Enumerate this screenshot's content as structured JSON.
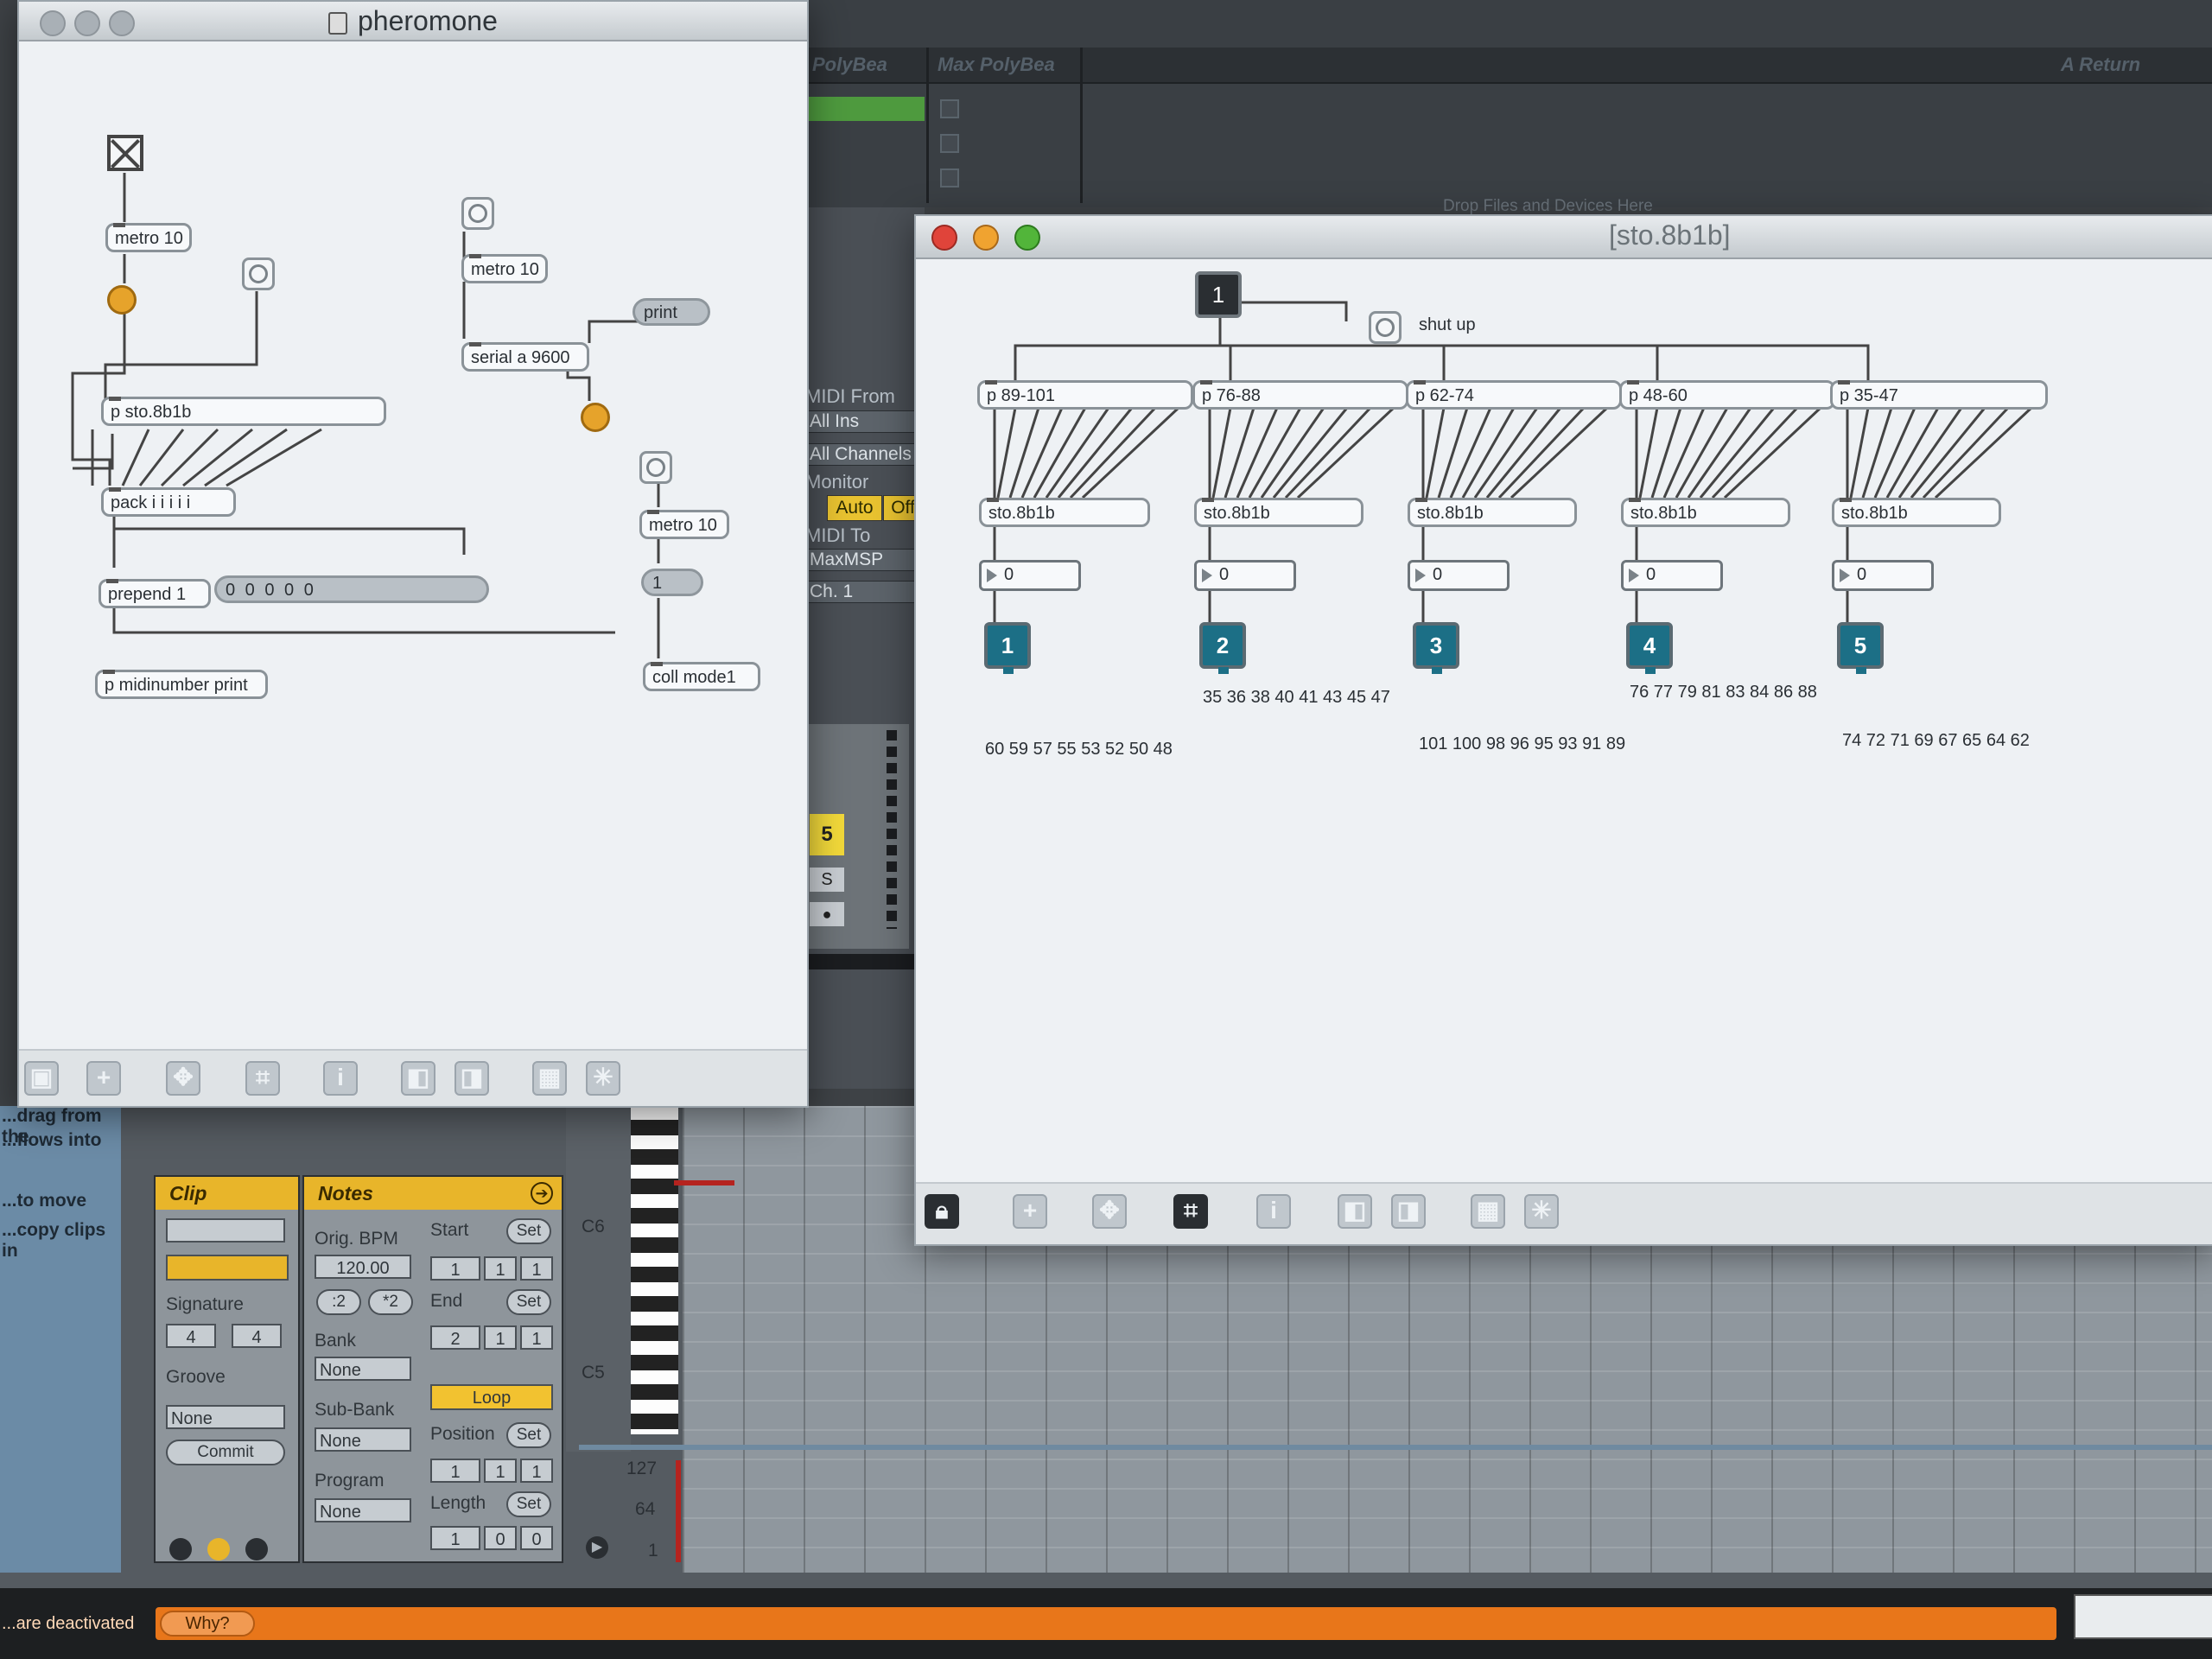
{
  "live": {
    "track_headers": [
      "PolyBea",
      "Max PolyBea",
      "A Return"
    ],
    "drop_hint": "Drop Files and Devices Here",
    "io": {
      "midi_from_label": "MIDI From",
      "midi_from_value": "All Ins",
      "channel_value": "All Channels",
      "monitor_label": "Monitor",
      "monitor_auto": "Auto",
      "monitor_off": "Off",
      "midi_to_label": "MIDI To",
      "midi_to_value": "MaxMSP",
      "midi_to_channel": "Ch. 1"
    },
    "track_number": "5",
    "solo": "S",
    "left_help": [
      "...drag from the",
      "...flows into",
      "...to move",
      "...copy clips in"
    ],
    "clip": {
      "header": "Clip",
      "signature_label": "Signature",
      "sig_num": "4",
      "sig_den": "4",
      "groove_label": "Groove",
      "groove_value": "None",
      "commit": "Commit"
    },
    "notes": {
      "header": "Notes",
      "orig_bpm_label": "Orig. BPM",
      "orig_bpm": "120.00",
      "half": ":2",
      "double": "*2",
      "bank_label": "Bank",
      "bank_value": "None",
      "subbank_label": "Sub-Bank",
      "subbank_value": "None",
      "program_label": "Program",
      "program_value": "None"
    },
    "loop": {
      "start_label": "Start",
      "start": [
        "1",
        "1",
        "1"
      ],
      "end_label": "End",
      "end": [
        "2",
        "1",
        "1"
      ],
      "loop_label": "Loop",
      "position_label": "Position",
      "position": [
        "1",
        "1",
        "1"
      ],
      "length_label": "Length",
      "length": [
        "1",
        "0",
        "0"
      ],
      "set_label": "Set"
    },
    "piano": {
      "c6": "C6",
      "c5": "C5"
    },
    "velocity": {
      "v127": "127",
      "v64": "64",
      "v1": "1"
    },
    "status": {
      "text": "...are deactivated",
      "why": "Why?"
    }
  },
  "pheromone": {
    "title": "pheromone",
    "objects": {
      "metro_a": "metro 10",
      "metro_b": "metro 10",
      "metro_c": "metro 10",
      "serial": "serial a 9600",
      "print": "print",
      "p_sto": "p sto.8b1b",
      "pack": "pack i i i i i",
      "prepend": "prepend 1",
      "list": "0 0 0 0 0",
      "one": "1",
      "coll": "coll mode1",
      "midinumber": "p midinumber print"
    }
  },
  "sto": {
    "title": "[sto.8b1b]",
    "top_button": "1",
    "shut_up": "shut up",
    "groups": [
      {
        "range": "p 89-101",
        "obj": "sto.8b1b",
        "num": "0",
        "out": "1",
        "notes": "60 59 57 55 53 52 50 48"
      },
      {
        "range": "p 76-88",
        "obj": "sto.8b1b",
        "num": "0",
        "out": "2",
        "notes": "35 36 38 40 41 43 45 47"
      },
      {
        "range": "p 62-74",
        "obj": "sto.8b1b",
        "num": "0",
        "out": "3",
        "notes": "101 100 98 96 95 93 91 89"
      },
      {
        "range": "p 48-60",
        "obj": "sto.8b1b",
        "num": "0",
        "out": "4",
        "notes": "76 77 79 81 83 84 86 88"
      },
      {
        "range": "p 35-47",
        "obj": "sto.8b1b",
        "num": "0",
        "out": "5",
        "notes": "74 72 71 69 67 65 64 62"
      }
    ]
  },
  "toolbar_icons": [
    "lock-icon",
    "add-icon",
    "move-icon",
    "presentation-icon",
    "info-icon",
    "front-icon",
    "back-icon",
    "grid-icon",
    "snap-icon"
  ],
  "colors": {
    "accent_orange": "#e8761a",
    "clip_yellow": "#e8b52a",
    "teal_outlet": "#1c6f86",
    "bang_lit": "#e6a32b"
  }
}
